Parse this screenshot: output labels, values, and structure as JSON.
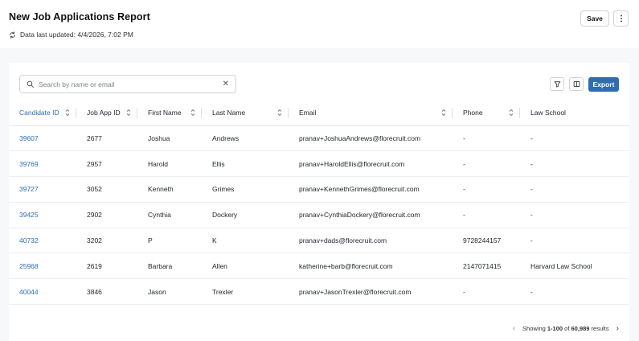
{
  "header": {
    "title": "New Job Applications Report",
    "updated": "Data last updated: 4/4/2026, 7:02 PM",
    "save_label": "Save",
    "more_icon": "more-vertical-icon"
  },
  "toolbar": {
    "search_placeholder": "Search by name or email",
    "search_value": "",
    "filter_icon": "filter-icon",
    "columns_icon": "columns-icon",
    "export_label": "Export"
  },
  "table": {
    "columns": [
      "Candidate ID",
      "Job App ID",
      "First Name",
      "Last Name",
      "Email",
      "Phone",
      "Law School"
    ],
    "rows": [
      [
        "39607",
        "2677",
        "Joshua",
        "Andrews",
        "pranav+JoshuaAndrews@florecruit.com",
        "-",
        "-"
      ],
      [
        "39769",
        "2957",
        "Harold",
        "Ellis",
        "pranav+HaroldEllis@florecruit.com",
        "-",
        "-"
      ],
      [
        "39727",
        "3052",
        "Kenneth",
        "Grimes",
        "pranav+KennethGrimes@florecruit.com",
        "-",
        "-"
      ],
      [
        "39425",
        "2902",
        "Cynthia",
        "Dockery",
        "pranav+CynthiaDockery@florecruit.com",
        "-",
        "-"
      ],
      [
        "40732",
        "3202",
        "P",
        "K",
        "pranav+dads@florecruit.com",
        "9728244157",
        "-"
      ],
      [
        "25968",
        "2619",
        "Barbara",
        "Allen",
        "katherine+barb@florecruit.com",
        "2147071415",
        "Harvard Law School"
      ],
      [
        "40044",
        "3846",
        "Jason",
        "Trexler",
        "pranav+JasonTrexler@florecruit.com",
        "-",
        "-"
      ]
    ]
  },
  "pagination": {
    "prefix": "Showing ",
    "range": "1-100",
    "of": " of ",
    "total": "60,989",
    "suffix": " results"
  },
  "colors": {
    "accent": "#2f6db3"
  }
}
